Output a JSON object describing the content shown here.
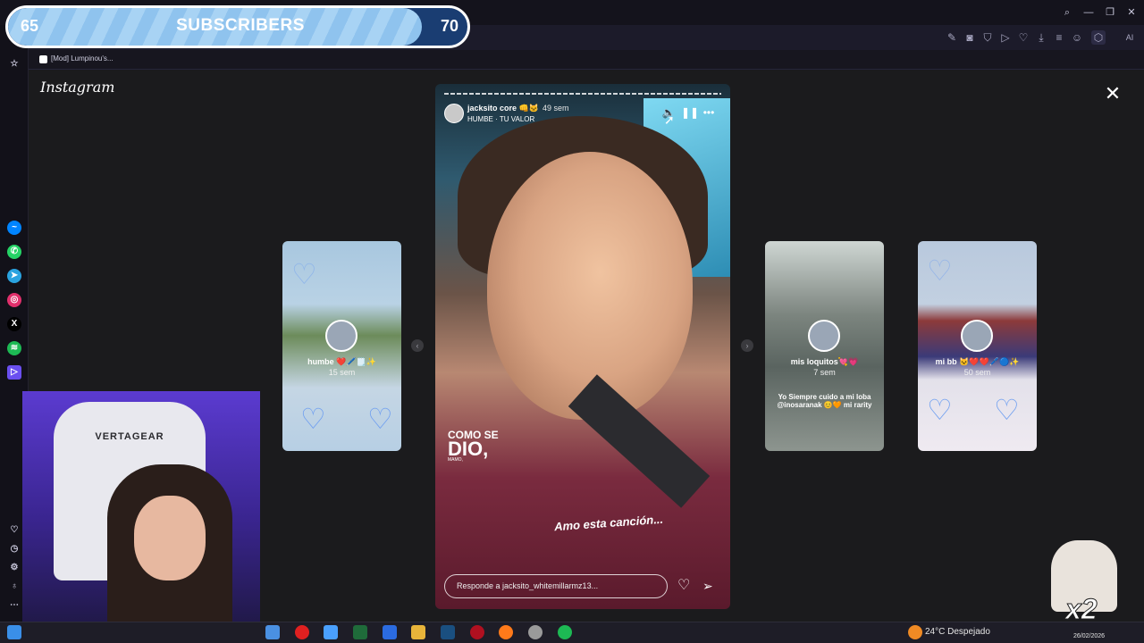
{
  "subscriber_goal": {
    "start": "65",
    "label": "SUBSCRIBERS",
    "goal": "70",
    "progress": 0.9
  },
  "browser": {
    "bookmark_tab": "[Mod] Lumpinou's..."
  },
  "instagram": {
    "logo": "Instagram",
    "story": {
      "username": "jacksito core 👊🐱",
      "time": "49 sem",
      "song": "HUMBE · TU VALOR",
      "caption_top": "COMO SE",
      "caption_big": "DIO,",
      "caption_small": "MAMO,",
      "caption_song": "Amo esta canción...",
      "reply_placeholder": "Responde a jacksito_whitemillarmz13..."
    },
    "side_cards": [
      {
        "name": "humbe ❤️🖊️🗒️✨",
        "time": "15 sem"
      },
      {
        "name": "mis loquitos💘💗",
        "time": "7 sem",
        "caption": "Yo Siempre cuido a mi loba @inosaranak 😊🧡 mi rarity"
      },
      {
        "name": "mi bb 🐱❤️❤️🖊️🔵✨",
        "time": "50 sem"
      }
    ]
  },
  "webcam": {
    "chair_brand": "VERTAGEAR"
  },
  "cat_overlay": {
    "multiplier": "x2"
  },
  "taskbar": {
    "weather": "24°C  Despejado",
    "date": "26/02/2026"
  },
  "colors": {
    "accent": "#6a4ff0",
    "sub_fill": "#8fc3ee",
    "sub_bg": "#1a3d72"
  }
}
